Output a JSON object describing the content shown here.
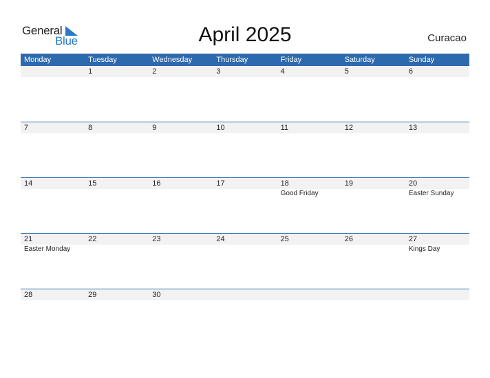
{
  "logo": {
    "general": "General",
    "blue": "Blue",
    "accent": "#2a7ac7"
  },
  "title": "April 2025",
  "country": "Curacao",
  "colors": {
    "header_bg": "#2d6aad",
    "day_row_bg": "#f2f2f2"
  },
  "weekdays": [
    "Monday",
    "Tuesday",
    "Wednesday",
    "Thursday",
    "Friday",
    "Saturday",
    "Sunday"
  ],
  "weeks": [
    {
      "days": [
        "",
        "1",
        "2",
        "3",
        "4",
        "5",
        "6"
      ],
      "holidays": [
        "",
        "",
        "",
        "",
        "",
        "",
        ""
      ]
    },
    {
      "days": [
        "7",
        "8",
        "9",
        "10",
        "11",
        "12",
        "13"
      ],
      "holidays": [
        "",
        "",
        "",
        "",
        "",
        "",
        ""
      ]
    },
    {
      "days": [
        "14",
        "15",
        "16",
        "17",
        "18",
        "19",
        "20"
      ],
      "holidays": [
        "",
        "",
        "",
        "",
        "Good Friday",
        "",
        "Easter Sunday"
      ]
    },
    {
      "days": [
        "21",
        "22",
        "23",
        "24",
        "25",
        "26",
        "27"
      ],
      "holidays": [
        "Easter Monday",
        "",
        "",
        "",
        "",
        "",
        "Kings Day"
      ]
    },
    {
      "days": [
        "28",
        "29",
        "30",
        "",
        "",
        "",
        ""
      ],
      "holidays": [
        "",
        "",
        "",
        "",
        "",
        "",
        ""
      ]
    }
  ]
}
